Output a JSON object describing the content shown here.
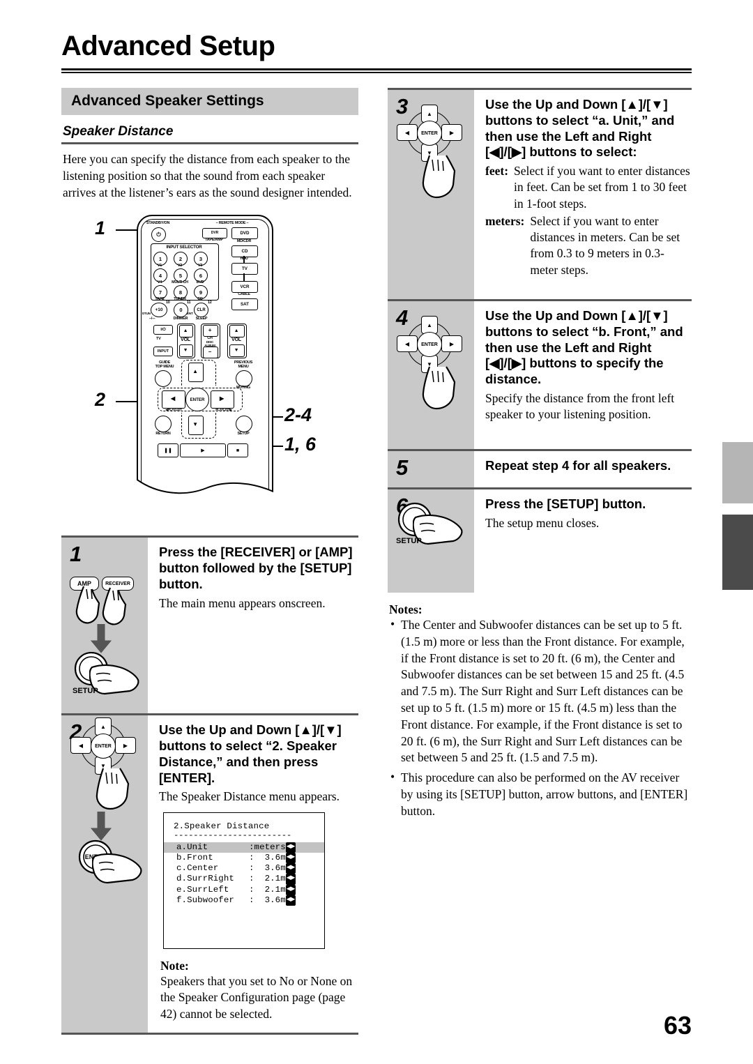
{
  "page": {
    "title": "Advanced Setup",
    "number": "63"
  },
  "section": {
    "bar_title": "Advanced Speaker Settings",
    "subhead": "Speaker Distance",
    "intro": "Here you can specify the distance from each speaker to the listening position so that the sound from each speaker arrives at the listener’s ears as the sound designer intended."
  },
  "figure": {
    "callouts": {
      "c1": "1",
      "c2": "2",
      "c3": "2-4",
      "c4": "1, 6"
    },
    "remote": {
      "standby": "STANDBY/ON",
      "remote_mode": "– REMOTE MODE –",
      "dvr": "DVR",
      "dvd": "DVD",
      "tape_amp": "TAPE/AMP",
      "md_cdr": "MD/CDR",
      "cd": "CD",
      "hdd": "HDD",
      "tv": "TV",
      "vcr": "VCR",
      "cable": "CABLE",
      "sat": "SAT",
      "input_selector": "INPUT SELECTOR",
      "numbers": [
        "1",
        "2",
        "3",
        "4",
        "5",
        "6",
        "7",
        "8",
        "9"
      ],
      "num_labels": [
        "V1",
        "V2",
        "V3",
        "V4",
        "MULTI CH",
        "DVD",
        "TAPE",
        "TUNER",
        "CD"
      ],
      "plus10": "+10",
      "zero": "0",
      "clr": "CLR",
      "small_10": "10",
      "small_11": "11",
      "small_12": "12",
      "dimmer": "DIMMER",
      "sleep": "SLEEP",
      "ent": "ENT",
      "dtun": "DTUN",
      "power_tv": "I/⏻",
      "input": "INPUT",
      "tv_label": "TV",
      "vol": "VOL",
      "ch": "CH",
      "disc": "DISC",
      "album": "ALBUM",
      "plus": "+",
      "minus": "–",
      "guide": "GUIDE",
      "top_menu": "TOP MENU",
      "previous": "PREVIOUS",
      "menu": "MENU",
      "muting": "MUTING",
      "enter": "ENTER",
      "return": "RETURN",
      "setup": "SETUP",
      "playlist_l": "PLAYLIST",
      "playlist_r": "PLAYLIST"
    }
  },
  "steps_left": [
    {
      "num": "1",
      "head": "Press the [RECEIVER] or [AMP] button followed by the [SETUP] button.",
      "sub": "The main menu appears onscreen.",
      "icons": {
        "amp": "AMP",
        "receiver": "RECEIVER",
        "setup": "SETUP"
      }
    },
    {
      "num": "2",
      "head": "Use the Up and Down [▲]/[▼] buttons to select “2. Speaker Distance,” and then press [ENTER].",
      "sub": "The Speaker Distance menu appears.",
      "icons": {
        "enter": "ENTER"
      }
    }
  ],
  "osd": {
    "title": "2.Speaker Distance",
    "separator": "------------------------",
    "rows": [
      {
        "name": "a.Unit",
        "value": ":meters",
        "arrows": "◀▶",
        "selected": true
      },
      {
        "name": "b.Front",
        "value": ":  3.6m",
        "arrows": "◀▶",
        "selected": false
      },
      {
        "name": "c.Center",
        "value": ":  3.6m",
        "arrows": "◀▶",
        "selected": false
      },
      {
        "name": "d.SurrRight",
        "value": ":  2.1m",
        "arrows": "◀▶",
        "selected": false
      },
      {
        "name": "e.SurrLeft",
        "value": ":  2.1m",
        "arrows": "◀▶",
        "selected": false
      },
      {
        "name": "f.Subwoofer",
        "value": ":  3.6m",
        "arrows": "◀▶",
        "selected": false
      }
    ]
  },
  "note_left": {
    "title": "Note:",
    "text": "Speakers that you set to No or None on the Speaker Configuration page (page 42) cannot be selected."
  },
  "steps_right": [
    {
      "num": "3",
      "head": "Use the Up and Down [▲]/[▼] buttons to select “a. Unit,” and then use the Left and Right [◀]/[▶] buttons to select:",
      "def1_term": "feet:",
      "def1_desc": "Select if you want to enter distances in feet. Can be set from 1 to 30 feet in 1-foot steps.",
      "def2_term": "meters:",
      "def2_desc": "Select if you want to enter distances in meters. Can be set from 0.3 to 9 meters in 0.3-meter steps."
    },
    {
      "num": "4",
      "head": "Use the Up and Down [▲]/[▼] buttons to select “b. Front,” and then use the Left and Right [◀]/[▶] buttons to specify the distance.",
      "sub": "Specify the distance from the front left speaker to your listening position."
    },
    {
      "num": "5",
      "head": "Repeat step 4 for all speakers.",
      "sub": ""
    },
    {
      "num": "6",
      "head": "Press the [SETUP] button.",
      "sub": "The setup menu closes.",
      "icons": {
        "setup": "SETUP"
      }
    }
  ],
  "notes_right": {
    "title": "Notes:",
    "items": [
      "The Center and Subwoofer distances can be set up to 5 ft. (1.5 m) more or less than the Front distance. For example, if the Front distance is set to 20 ft. (6 m), the Center and Subwoofer distances can be set between 15 and 25 ft. (4.5 and 7.5 m). The Surr Right and Surr Left distances can be set up to 5 ft. (1.5 m) more or 15 ft. (4.5 m) less than the Front distance. For example, if the Front distance is set to 20 ft. (6 m), the Surr Right and Surr Left distances can be set between 5 and 25 ft. (1.5 and 7.5 m).",
      "This procedure can also be performed on the AV receiver by using its [SETUP] button, arrow buttons, and [ENTER] button."
    ]
  },
  "colors": {
    "panel_gray": "#c9c9c9",
    "rule_gray": "#555555",
    "tab_gray": "#b5b5b5",
    "tab_dark": "#4b4b4b"
  }
}
